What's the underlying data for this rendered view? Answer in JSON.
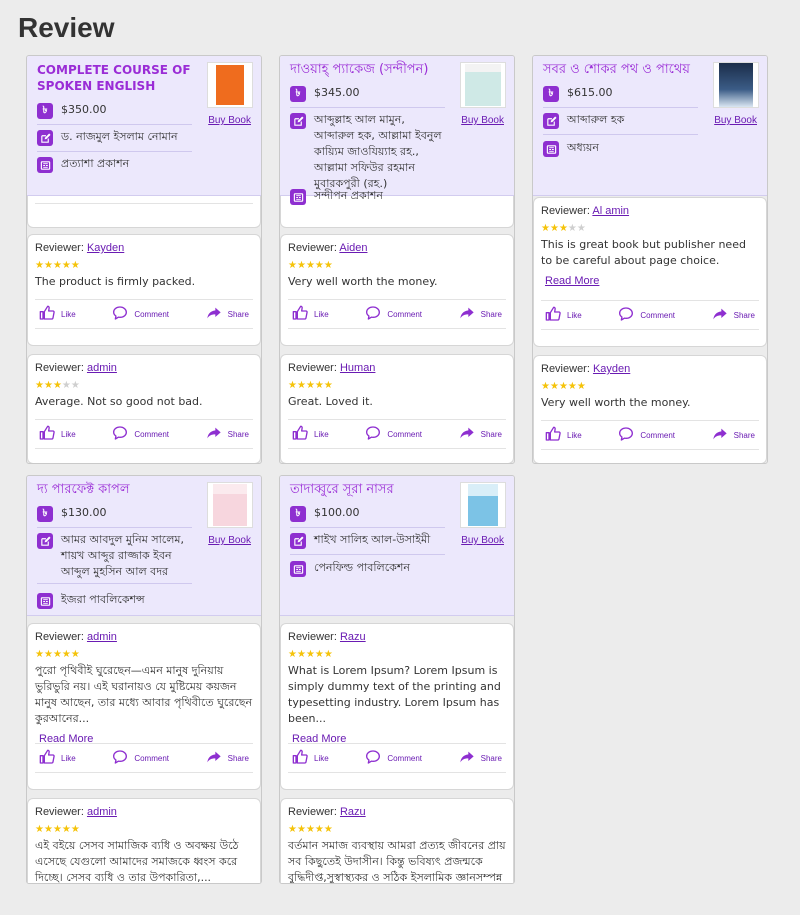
{
  "page": {
    "title": "Review"
  },
  "labels": {
    "buy": "Buy Book",
    "reviewer": "Reviewer:",
    "like": "Like",
    "comment": "Comment",
    "share": "Share",
    "read_more": "Read More"
  },
  "books": [
    {
      "title": "COMPLETE COURSE OF SPOKEN ENGLISH",
      "price": "$350.00",
      "author": "ড. নাজমুল ইসলাম নোমান",
      "publisher": "প্রত্যাশা প্রকাশন",
      "reviews": [
        {
          "reviewer": "Kayden",
          "rating": 5,
          "text": "The product is firmly packed."
        },
        {
          "reviewer": "admin",
          "rating": 3,
          "text": "Average. Not so good not bad."
        }
      ]
    },
    {
      "title": "দাওয়াহ্ প্যাকেজ (সন্দীপন)",
      "price": "$345.00",
      "author": "আব্দুল্লাহ আল মামুন, আব্দারুল হক, আল্লামা ইবনুল কায়্যিম জাওযিয়্যাহ রহ., আল্লামা সফিউর রহমান মুবারকপুরী (রহ.)",
      "publisher": "সন্দীপন প্রকাশন",
      "reviews": [
        {
          "reviewer": "Aiden",
          "rating": 5,
          "text": "Very well worth the money."
        },
        {
          "reviewer": "Human",
          "rating": 5,
          "text": "Great. Loved it."
        }
      ]
    },
    {
      "title": "সবর ও শোকর পথ ও পাথেয়",
      "price": "$615.00",
      "author": "আব্দারুল হক",
      "publisher": "অধ্যয়ন",
      "reviews": [
        {
          "reviewer": "Al amin",
          "rating": 3,
          "text": "This is great book but publisher need to be careful about page choice.",
          "read_more": true
        },
        {
          "reviewer": "Kayden",
          "rating": 5,
          "text": "Very well worth the money."
        }
      ]
    },
    {
      "title": "দ্য পারফেক্ট কাপল",
      "price": "$130.00",
      "author": "আমর আবদুল মুনিম সালেম, শায়খ আব্দুর রাজ্জাক ইবন আব্দুল মুহসিন আল বদর",
      "publisher": "ইজরা পাবলিকেশন্স",
      "reviews": [
        {
          "reviewer": "admin",
          "rating": 5,
          "text": "পুরো পৃথিবীই ঘুরেছেন—এমন মানুষ দুনিয়ায় ভুরিভুরি নয়। এই ঘরানায়ও যে মুষ্টিমেয় কয়জন মানুষ আছেন, তার মধ্যে আবার পৃথিবীতে ঘুরেছেন কুরআনের...",
          "read_more": true
        },
        {
          "reviewer": "admin",
          "rating": 5,
          "text": "এই বইয়ে সেসব সামাজিক ব্যধি ও অবক্ষয় উঠে এসেছে যেগুলো আমাদের সমাজকে ধ্বংস করে দিচ্ছে। সেসব ব্যধি ও তার উপকারিতা,..."
        }
      ]
    },
    {
      "title": "তাদাব্বুরে সূরা নাসর",
      "price": "$100.00",
      "author": "শাইখ সালিহ আল-উসাইমী",
      "publisher": "পেনফিল্ড পাবলিকেশন",
      "reviews": [
        {
          "reviewer": "Razu",
          "rating": 5,
          "text": "What is Lorem Ipsum? Lorem Ipsum is simply dummy text of the printing and typesetting industry. Lorem Ipsum has been...",
          "read_more": true
        },
        {
          "reviewer": "Razu",
          "rating": 5,
          "text": "বর্তমান সমাজ ব্যবস্থায় আমরা প্রত্যহ জীবনের প্রায় সব কিছুতেই উদাসীন। কিন্তু ভবিষ্যৎ প্রজন্মকে বুদ্ধিদীপ্ত,সুস্বাস্থ্যকর ও সঠিক ইসলামিক জ্ঞানসম্পন্ন"
        }
      ]
    }
  ],
  "icons": {
    "price": "taka-icon",
    "author": "pen-square-icon",
    "publisher": "newspaper-icon",
    "like": "thumb-up-icon",
    "comment": "chat-bubble-icon",
    "share": "share-arrow-icon"
  },
  "colors": {
    "accent": "#8e2fd0",
    "header_bg": "#ece8fc",
    "star": "#f5c30a"
  }
}
